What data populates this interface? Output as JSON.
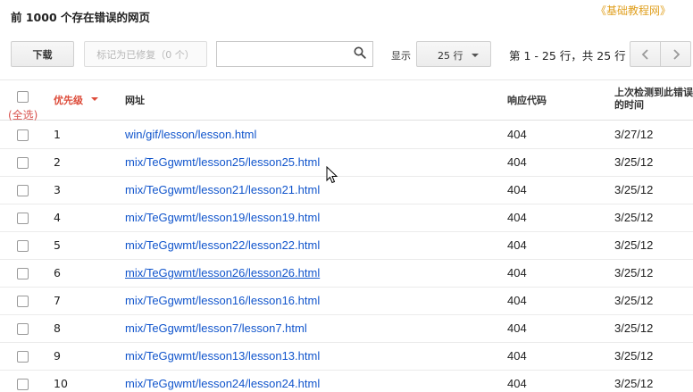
{
  "header": {
    "title": "前 1000 个存在错误的网页",
    "watermark": "《基础教程网》"
  },
  "toolbar": {
    "download_label": "下载",
    "mark_fixed_label": "标记为已修复（0 个）",
    "search_placeholder": "",
    "show_label": "显示",
    "rows_per_page": "25 行",
    "pagination_text": "第 1 - 25 行，共 25 行"
  },
  "table": {
    "select_all_label": "(全选)",
    "columns": {
      "priority": "优先级",
      "url": "网址",
      "response_code": "响应代码",
      "last_detected": "上次检测到此错误的时间"
    },
    "rows": [
      {
        "priority": "1",
        "url": "win/gif/lesson/lesson.html",
        "code": "404",
        "date": "3/27/12"
      },
      {
        "priority": "2",
        "url": "mix/TeGgwmt/lesson25/lesson25.html",
        "code": "404",
        "date": "3/25/12"
      },
      {
        "priority": "3",
        "url": "mix/TeGgwmt/lesson21/lesson21.html",
        "code": "404",
        "date": "3/25/12"
      },
      {
        "priority": "4",
        "url": "mix/TeGgwmt/lesson19/lesson19.html",
        "code": "404",
        "date": "3/25/12"
      },
      {
        "priority": "5",
        "url": "mix/TeGgwmt/lesson22/lesson22.html",
        "code": "404",
        "date": "3/25/12"
      },
      {
        "priority": "6",
        "url": "mix/TeGgwmt/lesson26/lesson26.html",
        "code": "404",
        "date": "3/25/12"
      },
      {
        "priority": "7",
        "url": "mix/TeGgwmt/lesson16/lesson16.html",
        "code": "404",
        "date": "3/25/12"
      },
      {
        "priority": "8",
        "url": "mix/TeGgwmt/lesson7/lesson7.html",
        "code": "404",
        "date": "3/25/12"
      },
      {
        "priority": "9",
        "url": "mix/TeGgwmt/lesson13/lesson13.html",
        "code": "404",
        "date": "3/25/12"
      },
      {
        "priority": "10",
        "url": "mix/TeGgwmt/lesson24/lesson24.html",
        "code": "404",
        "date": "3/25/12"
      }
    ]
  },
  "icons": {
    "search": "search-icon",
    "prev": "chevron-left-icon",
    "next": "chevron-right-icon",
    "sort": "sort-desc-icon",
    "cursor": "mouse-pointer-icon"
  },
  "colors": {
    "link": "#1155cc",
    "sort_active": "#dd4b39",
    "watermark": "#e0a020"
  }
}
